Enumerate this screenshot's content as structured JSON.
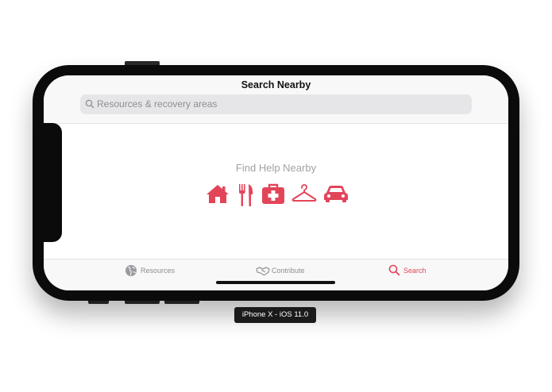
{
  "app": {
    "nav_title": "Search Nearby",
    "search": {
      "placeholder": "Resources & recovery areas",
      "icon": "search-icon"
    }
  },
  "main": {
    "heading": "Find Help Nearby",
    "categories": [
      {
        "icon": "house-icon",
        "color": "#e2455a"
      },
      {
        "icon": "fork-knife-icon",
        "color": "#e2455a"
      },
      {
        "icon": "first-aid-kit-icon",
        "color": "#e2455a"
      },
      {
        "icon": "clothes-hanger-icon",
        "color": "#e2455a"
      },
      {
        "icon": "car-icon",
        "color": "#e2455a"
      }
    ]
  },
  "tabbar": {
    "tabs": [
      {
        "label": "Resources",
        "icon": "globe-icon",
        "active": false
      },
      {
        "label": "Contribute",
        "icon": "handshake-icon",
        "active": false
      },
      {
        "label": "Search",
        "icon": "search-icon",
        "active": true
      }
    ],
    "active_color": "#e2455a",
    "inactive_color": "#8e8e93"
  },
  "device_label": "iPhone X - iOS 11.0"
}
